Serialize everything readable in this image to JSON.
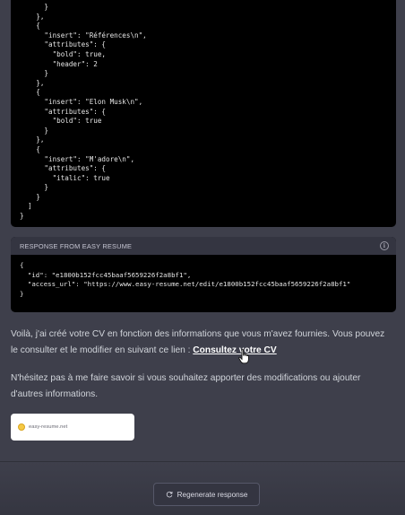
{
  "code_block": {
    "lines": [
      "      }",
      "    },",
      "    {",
      "      \"insert\": \"Références\\n\",",
      "      \"attributes\": {",
      "        \"bold\": true,",
      "        \"header\": 2",
      "      }",
      "    },",
      "    {",
      "      \"insert\": \"Elon Musk\\n\",",
      "      \"attributes\": {",
      "        \"bold\": true",
      "      }",
      "    },",
      "    {",
      "      \"insert\": \"M'adore\\n\",",
      "      \"attributes\": {",
      "        \"italic\": true",
      "      }",
      "    }",
      "  ]",
      "}"
    ]
  },
  "response_panel": {
    "title": "RESPONSE FROM EASY RESUME",
    "info_icon": "info-icon",
    "lines": [
      "{",
      "  \"id\": \"e1800b152fcc45baaf5659226f2a8bf1\",",
      "  \"access_url\": \"https://www.easy-resume.net/edit/e1800b152fcc45baaf5659226f2a8bf1\"",
      "}"
    ]
  },
  "message": {
    "para1_text": "Voilà, j'ai créé votre CV en fonction des informations que vous m'avez fournies. Vous pouvez le consulter et le modifier en suivant ce lien : ",
    "link_text": "Consultez votre CV",
    "para2_text": "N'hésitez pas à me faire savoir si vous souhaitez apporter des modifications ou ajouter d'autres informations."
  },
  "link_card": {
    "domain": "easy-resume.net"
  },
  "footer": {
    "regenerate_label": "Regenerate response",
    "regenerate_icon": "refresh-icon"
  },
  "colors": {
    "background": "#3e3f4b",
    "code_background": "#000000",
    "header_background": "#343541",
    "text": "#d1d5db",
    "link": "#ffffff"
  }
}
